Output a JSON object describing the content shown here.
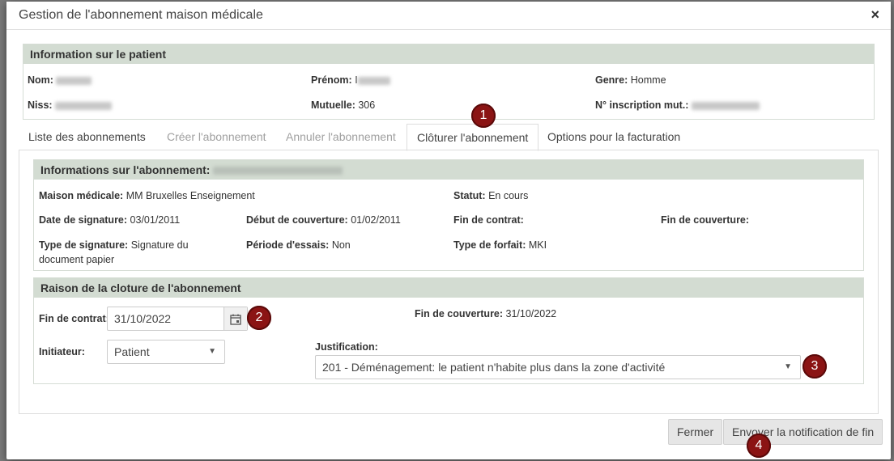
{
  "modal": {
    "title": "Gestion de l'abonnement maison médicale",
    "close_symbol": "×"
  },
  "patient": {
    "header": "Information sur le patient",
    "nom_label": "Nom:",
    "prenom_label": "Prénom:",
    "prenom_value_prefix": "I",
    "genre_label": "Genre:",
    "genre_value": "Homme",
    "niss_label": "Niss:",
    "mutuelle_label": "Mutuelle:",
    "mutuelle_value": "306",
    "inscription_label": "N° inscription mut.:"
  },
  "tabs": [
    {
      "label": "Liste des abonnements",
      "state": "normal"
    },
    {
      "label": "Créer l'abonnement",
      "state": "disabled"
    },
    {
      "label": "Annuler l'abonnement",
      "state": "disabled"
    },
    {
      "label": "Clôturer l'abonnement",
      "state": "active"
    },
    {
      "label": "Options pour la facturation",
      "state": "normal"
    }
  ],
  "subscription": {
    "header": "Informations sur l'abonnement:",
    "maison_label": "Maison médicale:",
    "maison_value": "MM Bruxelles Enseignement",
    "statut_label": "Statut:",
    "statut_value": "En cours",
    "signature_date_label": "Date de signature:",
    "signature_date_value": "03/01/2011",
    "debut_label": "Début de couverture:",
    "debut_value": "01/02/2011",
    "fin_contrat_label": "Fin de contrat:",
    "fin_couverture_label": "Fin de couverture:",
    "type_signature_label": "Type de signature:",
    "type_signature_value_1": "Signature du",
    "type_signature_value_2": "document papier",
    "periode_label": "Période d'essais:",
    "periode_value": "Non",
    "type_forfait_label": "Type de forfait:",
    "type_forfait_value": "MKI"
  },
  "closure": {
    "header": "Raison de la cloture de l'abonnement",
    "fin_contrat_label": "Fin de contrat:",
    "fin_contrat_value": "31/10/2022",
    "fin_couverture_label": "Fin de couverture:",
    "fin_couverture_value": "31/10/2022",
    "initiateur_label": "Initiateur:",
    "initiateur_value": "Patient",
    "justification_label": "Justification:",
    "justification_value": "201 - Déménagement: le patient n'habite plus dans la zone d'activité"
  },
  "footer": {
    "close_label": "Fermer",
    "send_label": "Envoyer la notification de fin"
  },
  "badges": [
    "1",
    "2",
    "3",
    "4"
  ],
  "colors": {
    "panel_header": "#d3dcd2",
    "badge": "#8b1414"
  }
}
